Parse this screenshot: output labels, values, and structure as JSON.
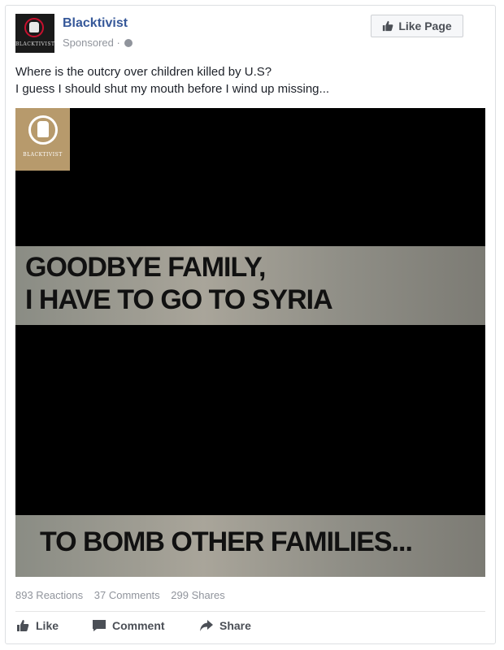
{
  "post": {
    "page_name": "Blacktivist",
    "sponsored_label": "Sponsored",
    "sponsored_separator": "·",
    "like_page_label": "Like Page",
    "avatar_text": "BLACKTIVIST",
    "message_lines": [
      "Where is the outcry over children killed by U.S?",
      "I guess I should shut my mouth before I wind up missing..."
    ]
  },
  "media": {
    "logo_text": "BLACKTIVIST",
    "caption_line1": "GOODBYE FAMILY,",
    "caption_line2": "I HAVE TO GO TO SYRIA",
    "caption_line3": "TO BOMB OTHER FAMILIES..."
  },
  "stats": {
    "reactions": "893 Reactions",
    "comments": "37 Comments",
    "shares": "299 Shares"
  },
  "actions": {
    "like": "Like",
    "comment": "Comment",
    "share": "Share"
  },
  "icons": {
    "globe": "globe-icon",
    "thumbs_up": "thumbs-up-icon",
    "comment": "comment-icon",
    "share": "share-icon"
  },
  "colors": {
    "link_blue": "#365899",
    "muted_gray": "#90949c",
    "action_gray": "#4b4f56"
  }
}
